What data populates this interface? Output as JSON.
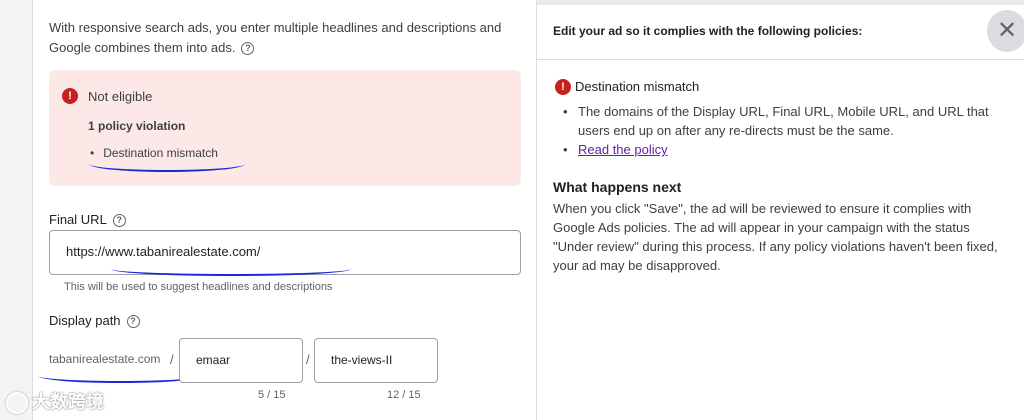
{
  "form": {
    "intro": "With responsive search ads, you enter multiple headlines and descriptions and Google combines them into ads.",
    "status": {
      "icon": "error-icon",
      "label": "Not eligible",
      "violation_count": "1 policy violation",
      "violations": [
        "Destination mismatch"
      ]
    },
    "final_url": {
      "label": "Final URL",
      "value": "https://www.tabanirealestate.com/",
      "hint": "This will be used to suggest headlines and descriptions"
    },
    "display_path": {
      "label": "Display path",
      "domain": "tabanirealestate.com",
      "separator": "/",
      "path1": "emaar",
      "path1_counter": "5 / 15",
      "path2": "the-views-II",
      "path2_counter": "12 / 15"
    }
  },
  "watermark": "大数跨境",
  "policy_panel": {
    "header": "Edit your ad so it complies with the following policies:",
    "close_icon": "close-icon",
    "policy_title": "Destination mismatch",
    "policy_text": "The domains of the Display URL, Final URL, Mobile URL, and URL that users end up on after any re-directs must be the same.",
    "policy_link": "Read the policy",
    "next_title": "What happens next",
    "next_body": "When you click \"Save\", the ad will be reviewed to ensure it complies with Google Ads policies. The ad will appear in your campaign with the status \"Under review\" during this process. If any policy violations haven't been fixed, your ad may be disapproved."
  },
  "colors": {
    "error": "#c5221f",
    "alert_bg": "#fce8e6",
    "link": "#681da8",
    "annotation_ink": "#1a2ad6"
  }
}
